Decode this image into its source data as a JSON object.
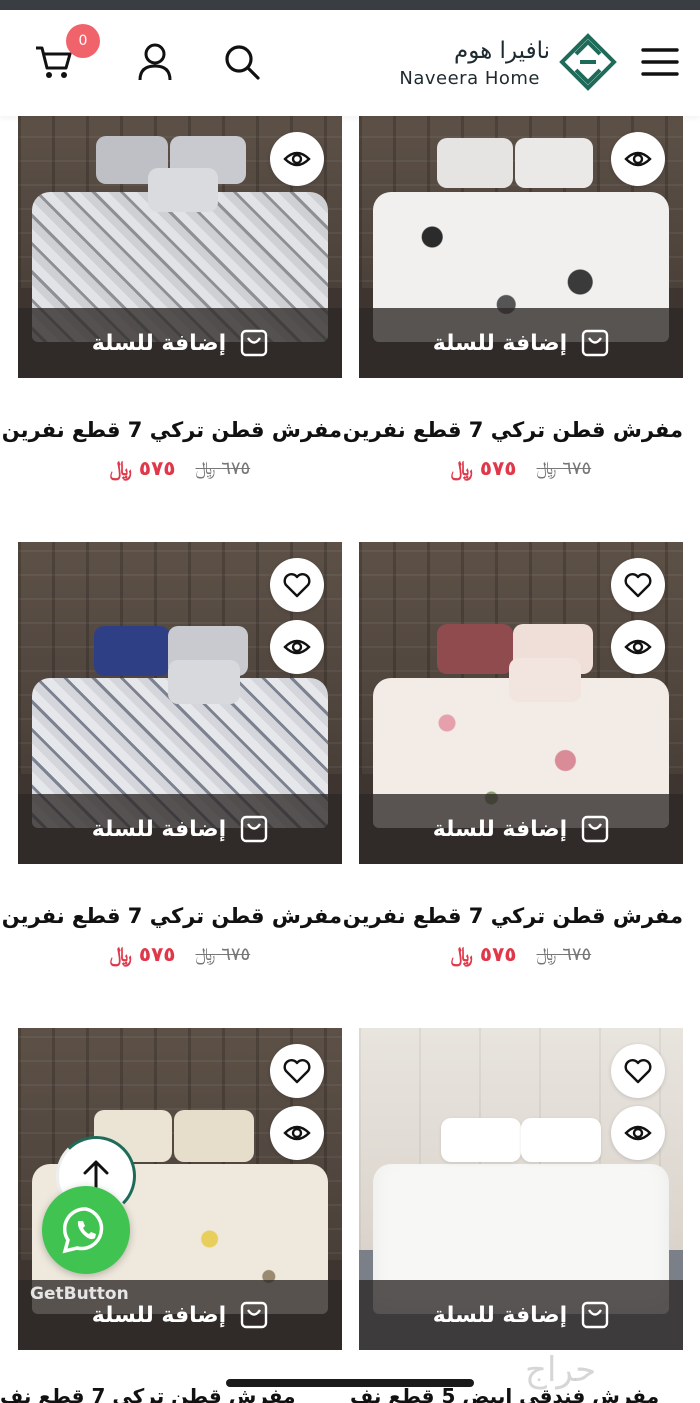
{
  "header": {
    "logo_ar": "نافيرا هوم",
    "logo_en": "Naveera Home",
    "cart_count": "0",
    "icons": [
      "cart-icon",
      "user-icon",
      "search-icon",
      "menu-icon"
    ]
  },
  "add_to_cart_label": "إضافة للسلة",
  "products": [
    {
      "title": "مفرش قطن تركي 7 قطع نفرين",
      "price_new": "٥٧٥",
      "price_old": "٦٧٥",
      "currency": "﷼"
    },
    {
      "title": "مفرش قطن تركي 7 قطع نفرين",
      "price_new": "٥٧٥",
      "price_old": "٦٧٥",
      "currency": "﷼"
    },
    {
      "title": "مفرش قطن تركي 7 قطع نفرين",
      "price_new": "٥٧٥",
      "price_old": "٦٧٥",
      "currency": "﷼"
    },
    {
      "title": "مفرش قطن تركي 7 قطع نفرين",
      "price_new": "٥٧٥",
      "price_old": "٦٧٥",
      "currency": "﷼"
    },
    {
      "title": "",
      "price_new": "",
      "price_old": "",
      "currency": ""
    },
    {
      "title": "",
      "price_new": "",
      "price_old": "",
      "currency": ""
    }
  ],
  "bottom_titles": [
    "مفرش قطن تركي 7 قطع نف",
    "مفرش فندقي ابيض 5 قطع نف"
  ],
  "getbutton_label": "GetButton",
  "watermark": "حراج",
  "colors": {
    "accent_price": "#e0384a",
    "whatsapp": "#40c351",
    "badge": "#f0636b",
    "logo_green": "#1f6b5a"
  }
}
